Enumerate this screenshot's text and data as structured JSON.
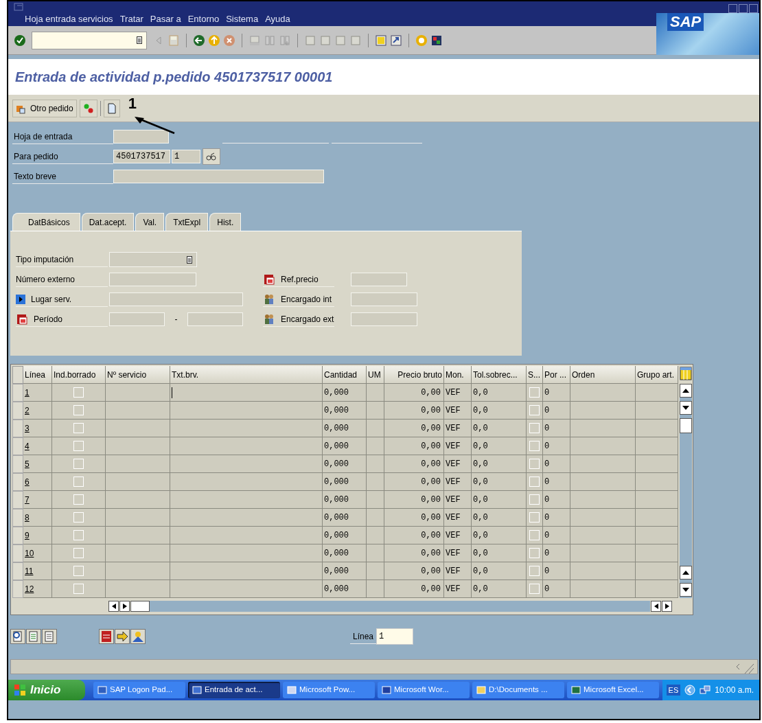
{
  "menu": [
    "Hoja entrada servicios",
    "Tratar",
    "Pasar a",
    "Entorno",
    "Sistema",
    "Ayuda"
  ],
  "logo": "SAP",
  "title": "Entrada de actividad p.pedido 4501737517 00001",
  "app_toolbar": {
    "other_order": "Otro pedido"
  },
  "annotation": "1",
  "header_fields": [
    {
      "label": "Hoja de entrada"
    },
    {
      "label": "Para pedido",
      "values": [
        "4501737517",
        "1"
      ]
    },
    {
      "label": "Texto breve"
    }
  ],
  "tabs": [
    {
      "label": "DatBásicos",
      "selected": true
    },
    {
      "label": "Dat.acept.",
      "selected": false
    },
    {
      "label": "Val.",
      "selected": false
    },
    {
      "label": "TxtExpl",
      "selected": false
    },
    {
      "label": "Hist.",
      "selected": false
    }
  ],
  "tab_fields_left": [
    {
      "label": "Tipo imputación",
      "kind": "dropdown"
    },
    {
      "label": "Número externo",
      "kind": "plain"
    },
    {
      "label": "Lugar serv.",
      "kind": "expand"
    },
    {
      "label": "Período",
      "kind": "range",
      "separator": "-"
    }
  ],
  "tab_fields_right": [
    {
      "label": "Ref.precio",
      "kind": "calendar"
    },
    {
      "label": "Encargado int",
      "kind": "people"
    },
    {
      "label": "Encargado ext",
      "kind": "people"
    }
  ],
  "table": {
    "columns": [
      "Línea",
      "Ind.borrado",
      "Nº servicio",
      "Txt.brv.",
      "Cantidad",
      "UM",
      "Precio bruto",
      "Mon.",
      "Tol.sobrec...",
      "S...",
      "Por ...",
      "Orden",
      "Grupo art."
    ],
    "rows": [
      {
        "line": "1",
        "deleted": false,
        "quantity": "0,000",
        "price": "0,00",
        "currency": "VEF",
        "tolerance": "0,0",
        "s": false,
        "por": "0"
      },
      {
        "line": "2",
        "deleted": false,
        "quantity": "0,000",
        "price": "0,00",
        "currency": "VEF",
        "tolerance": "0,0",
        "s": false,
        "por": "0"
      },
      {
        "line": "3",
        "deleted": false,
        "quantity": "0,000",
        "price": "0,00",
        "currency": "VEF",
        "tolerance": "0,0",
        "s": false,
        "por": "0"
      },
      {
        "line": "4",
        "deleted": false,
        "quantity": "0,000",
        "price": "0,00",
        "currency": "VEF",
        "tolerance": "0,0",
        "s": false,
        "por": "0"
      },
      {
        "line": "5",
        "deleted": false,
        "quantity": "0,000",
        "price": "0,00",
        "currency": "VEF",
        "tolerance": "0,0",
        "s": false,
        "por": "0"
      },
      {
        "line": "6",
        "deleted": false,
        "quantity": "0,000",
        "price": "0,00",
        "currency": "VEF",
        "tolerance": "0,0",
        "s": false,
        "por": "0"
      },
      {
        "line": "7",
        "deleted": false,
        "quantity": "0,000",
        "price": "0,00",
        "currency": "VEF",
        "tolerance": "0,0",
        "s": false,
        "por": "0"
      },
      {
        "line": "8",
        "deleted": false,
        "quantity": "0,000",
        "price": "0,00",
        "currency": "VEF",
        "tolerance": "0,0",
        "s": false,
        "por": "0"
      },
      {
        "line": "9",
        "deleted": false,
        "quantity": "0,000",
        "price": "0,00",
        "currency": "VEF",
        "tolerance": "0,0",
        "s": false,
        "por": "0"
      },
      {
        "line": "10",
        "deleted": false,
        "quantity": "0,000",
        "price": "0,00",
        "currency": "VEF",
        "tolerance": "0,0",
        "s": false,
        "por": "0"
      },
      {
        "line": "11",
        "deleted": false,
        "quantity": "0,000",
        "price": "0,00",
        "currency": "VEF",
        "tolerance": "0,0",
        "s": false,
        "por": "0"
      },
      {
        "line": "12",
        "deleted": false,
        "quantity": "0,000",
        "price": "0,00",
        "currency": "VEF",
        "tolerance": "0,0",
        "s": false,
        "por": "0"
      }
    ]
  },
  "line_field": {
    "label": "Línea",
    "value": "1"
  },
  "taskbar": {
    "start": "Inicio",
    "tasks": [
      {
        "label": "SAP Logon Pad...",
        "selected": false
      },
      {
        "label": "Entrada de act...",
        "selected": true
      },
      {
        "label": "Microsoft Pow...",
        "selected": false
      },
      {
        "label": "Microsoft Wor...",
        "selected": false
      },
      {
        "label": "D:\\Documents ...",
        "selected": false
      },
      {
        "label": "Microsoft Excel...",
        "selected": false
      }
    ],
    "language": "ES",
    "clock": "10:00 a.m."
  }
}
